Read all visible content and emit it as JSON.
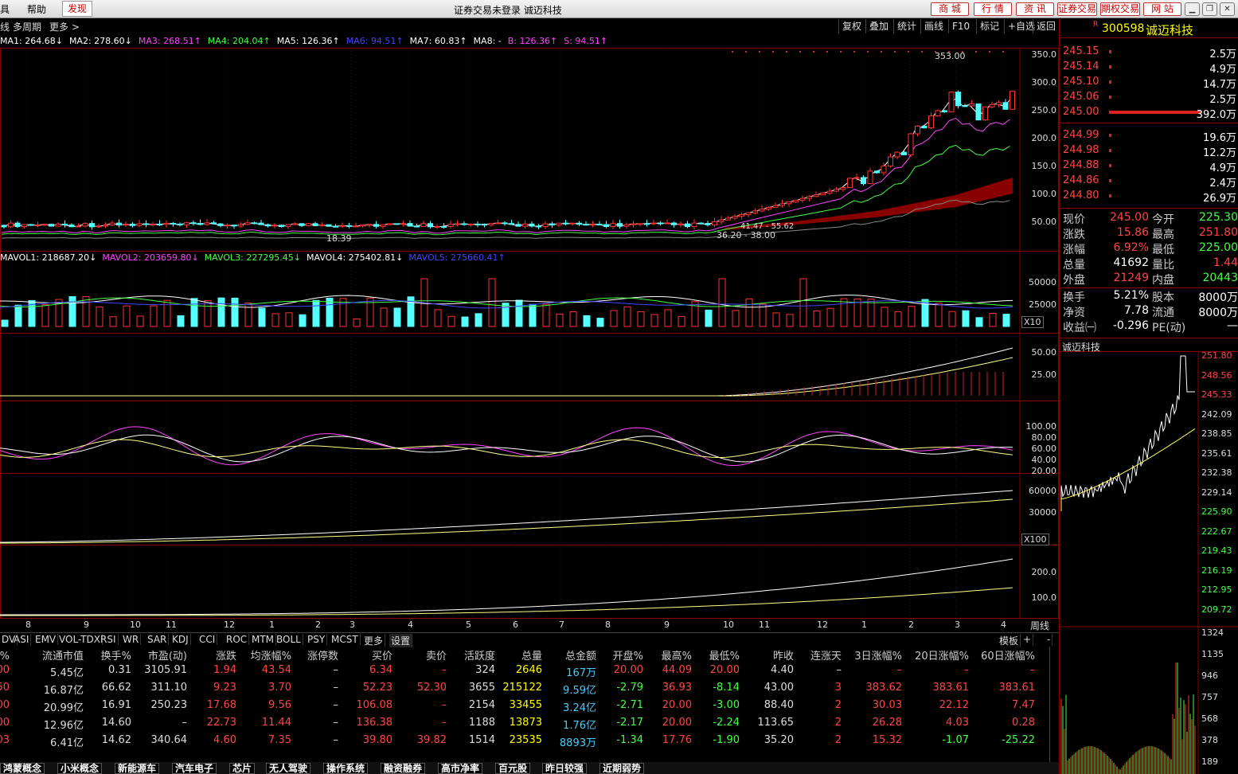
{
  "menus": [
    "具",
    "帮助",
    "发现"
  ],
  "window_title": "证券交易未登录 诚迈科技",
  "title_buttons": [
    "商 城",
    "行 情",
    "资 讯",
    "证券交易",
    "期权交易",
    "网 站"
  ],
  "toolbar_left": [
    "线",
    "多周期",
    "更多 >"
  ],
  "toolbar_right": [
    "复权",
    "叠加",
    "统计",
    "画线",
    "F10",
    "标记",
    "+自选",
    "返回"
  ],
  "ma": [
    {
      "t": "MA1: 264.68↓",
      "c": "#ffffff"
    },
    {
      "t": "MA2: 278.60↓",
      "c": "#ffffff"
    },
    {
      "t": "MA3: 268.51↑",
      "c": "#ff44ff"
    },
    {
      "t": "MA4: 204.04↑",
      "c": "#44ff44"
    },
    {
      "t": "MA5: 126.36↑",
      "c": "#ffffff"
    },
    {
      "t": "MA6: 94.51↑",
      "c": "#4444ff"
    },
    {
      "t": "MA7: 60.83↑",
      "c": "#ffffff"
    },
    {
      "t": "MA8: -",
      "c": "#ffffff"
    },
    {
      "t": "B: 126.36↑",
      "c": "#ff44ff"
    },
    {
      "t": "S: 94.51↑",
      "c": "#ff44ff"
    }
  ],
  "price_axis": [
    "350.0",
    "300.0",
    "250.0",
    "200.0",
    "150.0",
    "100.0",
    "50.00"
  ],
  "high_label": "353.00",
  "low_label": "18.39",
  "range_label1": "36.20 - 38.00",
  "range_label2": "41.47 - 55.62",
  "mavol": [
    {
      "t": "MAVOL1: 218687.20↓",
      "c": "#ffffff"
    },
    {
      "t": "MAVOL2: 203659.80↓",
      "c": "#ff44ff"
    },
    {
      "t": "MAVOL3: 227295.45↓",
      "c": "#44ff44"
    },
    {
      "t": "MAVOL4: 275402.81↓",
      "c": "#ffffff"
    },
    {
      "t": "MAVOL5: 275660.41↑",
      "c": "#4444ff"
    }
  ],
  "vol_axis": [
    "50000",
    "25000"
  ],
  "vol_mult": "X10",
  "ind1_axis": [
    "50.00",
    "25.00"
  ],
  "ind2_axis": [
    "100.00",
    "80.00",
    "60.00",
    "40.00",
    "20.00"
  ],
  "ind3_axis": [
    "60000",
    "30000"
  ],
  "ind3_mult": "X100",
  "ind4_axis": [
    "200.0",
    "100.0"
  ],
  "date_axis": [
    "8",
    "9",
    "10",
    "11",
    "12",
    "1",
    "2",
    "3",
    "4",
    "5",
    "6",
    "7",
    "8",
    "9",
    "10",
    "11",
    "12",
    "1",
    "2",
    "3",
    "4"
  ],
  "period": "周线",
  "tabs": [
    "DV",
    "ASI",
    "EMV",
    "VOL-TDX",
    "RSI",
    "WR",
    "SAR",
    "KDJ",
    "CCI",
    "ROC",
    "MTM",
    "BOLL",
    "PSY",
    "MCST",
    "更多",
    "设置"
  ],
  "tabs_right": [
    "模板",
    "+",
    "-"
  ],
  "stock": {
    "code": "300598",
    "name": "诚迈科技",
    "badge": "R"
  },
  "asks": [
    {
      "p": "245.15",
      "v": "2.5万",
      "bar": 0
    },
    {
      "p": "245.14",
      "v": "4.9万",
      "bar": 0
    },
    {
      "p": "245.10",
      "v": "14.7万",
      "bar": 0
    },
    {
      "p": "245.06",
      "v": "2.5万",
      "bar": 0
    },
    {
      "p": "245.00",
      "v": "392.0万",
      "bar": 1
    }
  ],
  "bids": [
    {
      "p": "244.99",
      "v": "19.6万",
      "bar": 0
    },
    {
      "p": "244.98",
      "v": "12.2万",
      "bar": 0
    },
    {
      "p": "244.88",
      "v": "4.9万",
      "bar": 0
    },
    {
      "p": "244.86",
      "v": "2.4万",
      "bar": 0
    },
    {
      "p": "244.80",
      "v": "26.9万",
      "bar": 0
    }
  ],
  "quote": [
    [
      "现价",
      "245.00",
      "#ff4444",
      "今开",
      "225.30",
      "#44ff44"
    ],
    [
      "涨跌",
      "15.86",
      "#ff4444",
      "最高",
      "251.80",
      "#ff4444"
    ],
    [
      "涨幅",
      "6.92%",
      "#ff4444",
      "最低",
      "225.00",
      "#44ff44"
    ],
    [
      "总量",
      "41692",
      "#ffffff",
      "量比",
      "1.44",
      "#ff4444"
    ],
    [
      "外盘",
      "21249",
      "#ff4444",
      "内盘",
      "20443",
      "#44ff44"
    ],
    [
      "换手",
      "5.21%",
      "#ffffff",
      "股本",
      "8000万",
      "#ffffff"
    ],
    [
      "净资",
      "7.78",
      "#ffffff",
      "流通",
      "8000万",
      "#ffffff"
    ],
    [
      "收益㈠",
      "-0.296",
      "#ffffff",
      "PE(动)",
      "—",
      "#ffffff"
    ]
  ],
  "mini_title": "诚迈科技",
  "mini_axis": [
    "251.80",
    "248.56",
    "245.33",
    "242.09",
    "238.85",
    "235.61",
    "232.38",
    "229.14",
    "225.90",
    "222.67",
    "219.43",
    "216.19",
    "212.95",
    "209.72"
  ],
  "mini_vol_axis": [
    "1324",
    "1135",
    "946",
    "757",
    "568",
    "378",
    "189"
  ],
  "table_headers": [
    "速%",
    "流通市值",
    "换手%",
    "市盈(动)",
    "涨跌",
    "均涨幅%",
    "涨停数",
    "买价",
    "卖价",
    "活跃度",
    "总量",
    "总金额",
    "开盘%",
    "最高%",
    "最低%",
    "昨收",
    "连涨天",
    "3日涨幅%",
    "20日涨幅%",
    "60日涨幅%"
  ],
  "table_rows": [
    [
      "00",
      "5.45亿",
      "0.31",
      "3105.91",
      "1.94",
      "43.54",
      "–",
      "6.34",
      "–",
      "324",
      "2646",
      "167万",
      "20.00",
      "44.09",
      "20.00",
      "4.40",
      "–",
      "–",
      "–",
      "–"
    ],
    [
      "50",
      "16.87亿",
      "66.62",
      "311.10",
      "9.23",
      "3.70",
      "–",
      "52.23",
      "52.30",
      "3655",
      "215122",
      "9.59亿",
      "-2.79",
      "36.93",
      "-8.14",
      "43.00",
      "3",
      "383.62",
      "383.61",
      "383.61"
    ],
    [
      "00",
      "20.99亿",
      "16.91",
      "250.23",
      "17.68",
      "9.56",
      "–",
      "106.08",
      "–",
      "2154",
      "33455",
      "3.24亿",
      "-2.71",
      "20.00",
      "-3.00",
      "88.40",
      "2",
      "30.03",
      "22.12",
      "7.47"
    ],
    [
      "00",
      "12.96亿",
      "14.60",
      "–",
      "22.73",
      "11.44",
      "–",
      "136.38",
      "–",
      "1188",
      "13873",
      "1.76亿",
      "-2.17",
      "20.00",
      "-2.24",
      "113.65",
      "2",
      "26.28",
      "4.03",
      "0.28"
    ],
    [
      "03",
      "6.41亿",
      "14.62",
      "340.64",
      "4.60",
      "7.35",
      "–",
      "39.80",
      "39.82",
      "1514",
      "23535",
      "8893万",
      "-1.34",
      "17.76",
      "-1.90",
      "35.20",
      "2",
      "15.32",
      "-1.07",
      "-25.22"
    ]
  ],
  "sectors": [
    "鸿蒙概念",
    "小米概念",
    "新能源车",
    "汽车电子",
    "芯片",
    "无人驾驶",
    "操作系统",
    "融资融券",
    "高市净率",
    "百元股",
    "昨日较强",
    "近期弱势"
  ]
}
